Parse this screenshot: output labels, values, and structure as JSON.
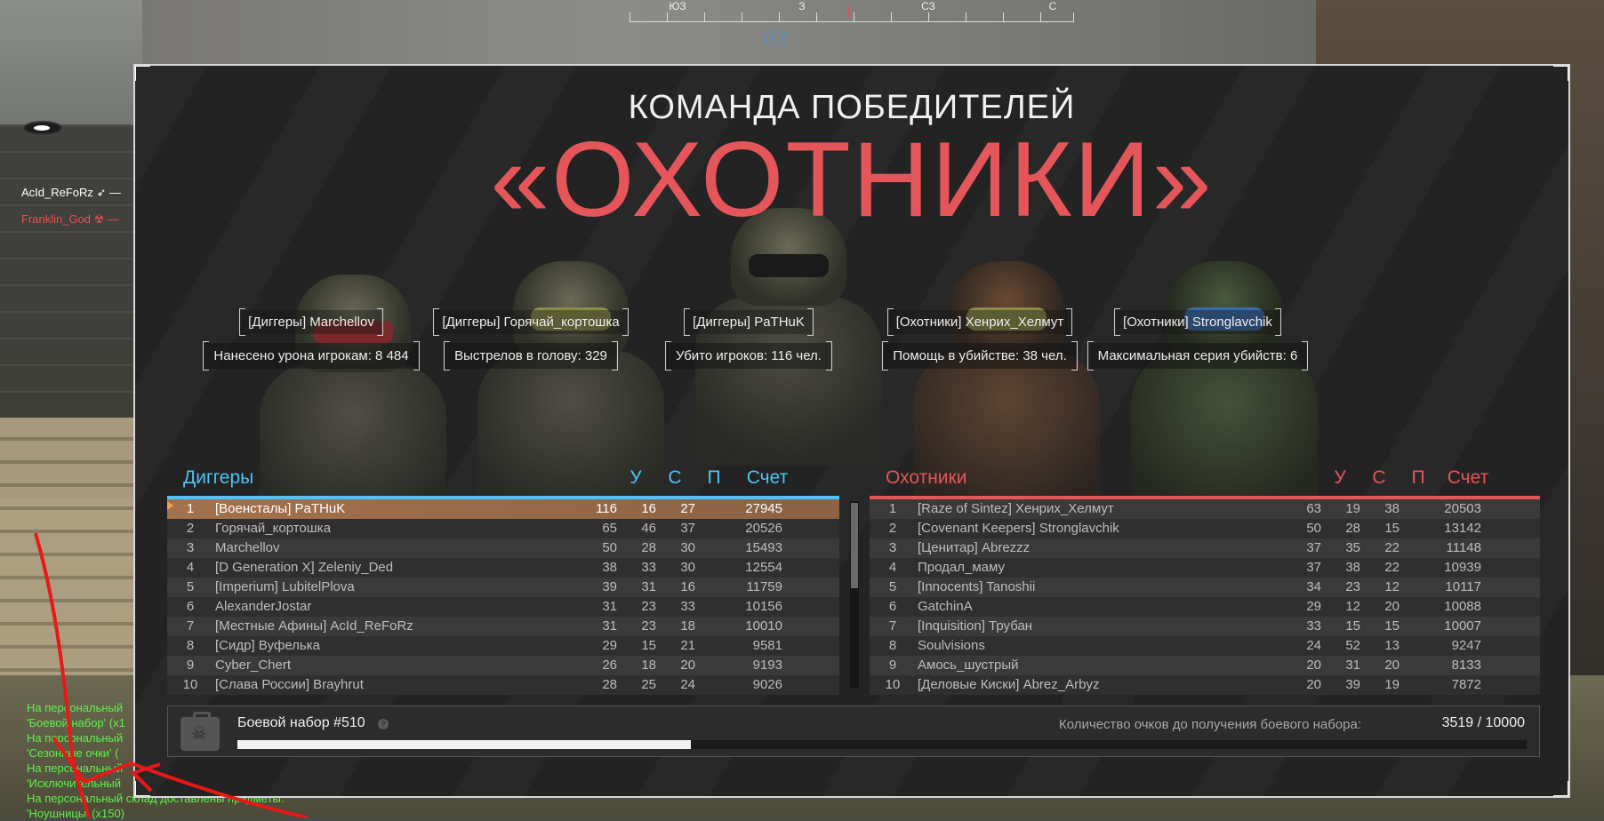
{
  "compass": {
    "labels": [
      "ЮЗ",
      "З",
      "СЗ",
      "С"
    ],
    "chevrons": "❮❮❮"
  },
  "kill_feed": [
    {
      "name": "AcId_ReFoRz",
      "team": "green"
    },
    {
      "name": "Franklin_God",
      "team": "red"
    }
  ],
  "chat_lines": [
    "На персональный",
    "'Боевой набор' (x1",
    "На персональный",
    "'Сезонные очки' (",
    "На персональный",
    "'Исключительный",
    "На персональный склад доставлены предметы:",
    "'Ноушницы' (x150)"
  ],
  "result": {
    "caption": "КОМАНДА ПОБЕДИТЕЛЕЙ",
    "winner_team": "«ОХОТНИКИ»"
  },
  "highlights": [
    {
      "name": "[Диггеры] Marchellov",
      "stat": "Нанесено урона игрокам: 8 484"
    },
    {
      "name": "[Диггеры] Горячай_кортошка",
      "stat": "Выстрелов в голову: 329"
    },
    {
      "name": "[Диггеры] PaTHuK",
      "stat": "Убито игроков: 116 чел."
    },
    {
      "name": "[Охотники] Хенрих_Хелмут",
      "stat": "Помощь в убийстве: 38 чел."
    },
    {
      "name": "[Охотники] Stronglavchik",
      "stat": "Максимальная серия убийств: 6"
    }
  ],
  "columns": [
    "У",
    "С",
    "П",
    "Счет"
  ],
  "teams": [
    {
      "name": "Диггеры",
      "color": "#4fc3f7",
      "rows": [
        {
          "rank": "1",
          "name": "[Военсталы] PaTHuK",
          "k": "116",
          "d": "16",
          "a": "27",
          "score": "27945",
          "highlight": true
        },
        {
          "rank": "2",
          "name": "Горячай_кортошка",
          "k": "65",
          "d": "46",
          "a": "37",
          "score": "20526"
        },
        {
          "rank": "3",
          "name": "Marchellov",
          "k": "50",
          "d": "28",
          "a": "30",
          "score": "15493"
        },
        {
          "rank": "4",
          "name": "[D Generation X] Zeleniy_Ded",
          "k": "38",
          "d": "33",
          "a": "30",
          "score": "12554"
        },
        {
          "rank": "5",
          "name": "[Imperium] LubitelPlova",
          "k": "39",
          "d": "31",
          "a": "16",
          "score": "11759"
        },
        {
          "rank": "6",
          "name": "AlexanderJostar",
          "k": "31",
          "d": "23",
          "a": "33",
          "score": "10156"
        },
        {
          "rank": "7",
          "name": "[Местные Афины] AcId_ReFoRz",
          "k": "31",
          "d": "23",
          "a": "18",
          "score": "10010"
        },
        {
          "rank": "8",
          "name": "[Сидр] Вуфелька",
          "k": "29",
          "d": "15",
          "a": "21",
          "score": "9581"
        },
        {
          "rank": "9",
          "name": "Cyber_Chert",
          "k": "26",
          "d": "18",
          "a": "20",
          "score": "9193"
        },
        {
          "rank": "10",
          "name": "[Слава России] Brayhrut",
          "k": "28",
          "d": "25",
          "a": "24",
          "score": "9026"
        }
      ]
    },
    {
      "name": "Охотники",
      "color": "#e5565a",
      "rows": [
        {
          "rank": "1",
          "name": "[Raze of Sintez] Хенрих_Хелмут",
          "k": "63",
          "d": "19",
          "a": "38",
          "score": "20503"
        },
        {
          "rank": "2",
          "name": "[Covenant Keepers] Stronglavchik",
          "k": "50",
          "d": "28",
          "a": "15",
          "score": "13142"
        },
        {
          "rank": "3",
          "name": "[Ценитар] Abrezzz",
          "k": "37",
          "d": "35",
          "a": "22",
          "score": "11148"
        },
        {
          "rank": "4",
          "name": "Продал_маму",
          "k": "37",
          "d": "38",
          "a": "22",
          "score": "10939"
        },
        {
          "rank": "5",
          "name": "[Innocents] Tanoshii",
          "k": "34",
          "d": "23",
          "a": "12",
          "score": "10117"
        },
        {
          "rank": "6",
          "name": "GatchinA",
          "k": "29",
          "d": "12",
          "a": "20",
          "score": "10088"
        },
        {
          "rank": "7",
          "name": "[Inquisition] Трубан",
          "k": "33",
          "d": "15",
          "a": "15",
          "score": "10007"
        },
        {
          "rank": "8",
          "name": "Soulvisions",
          "k": "24",
          "d": "52",
          "a": "13",
          "score": "9247"
        },
        {
          "rank": "9",
          "name": "Амось_шустрый",
          "k": "20",
          "d": "31",
          "a": "20",
          "score": "8133"
        },
        {
          "rank": "10",
          "name": "[Деловые Киски] Abrez_Arbyz",
          "k": "20",
          "d": "39",
          "a": "19",
          "score": "7872"
        }
      ]
    }
  ],
  "kit": {
    "title": "Боевой набор #510",
    "help": "?",
    "progress_label": "Количество очков до получения боевого набора:",
    "progress_value": "3519 / 10000",
    "progress_fraction": 0.3519
  },
  "colors": {
    "panel_bg": "#232323",
    "winner_red": "#e5565a",
    "diggers_blue": "#4fc3f7",
    "highlight_row": "#a5714d",
    "chat_green": "#5cf24b"
  }
}
